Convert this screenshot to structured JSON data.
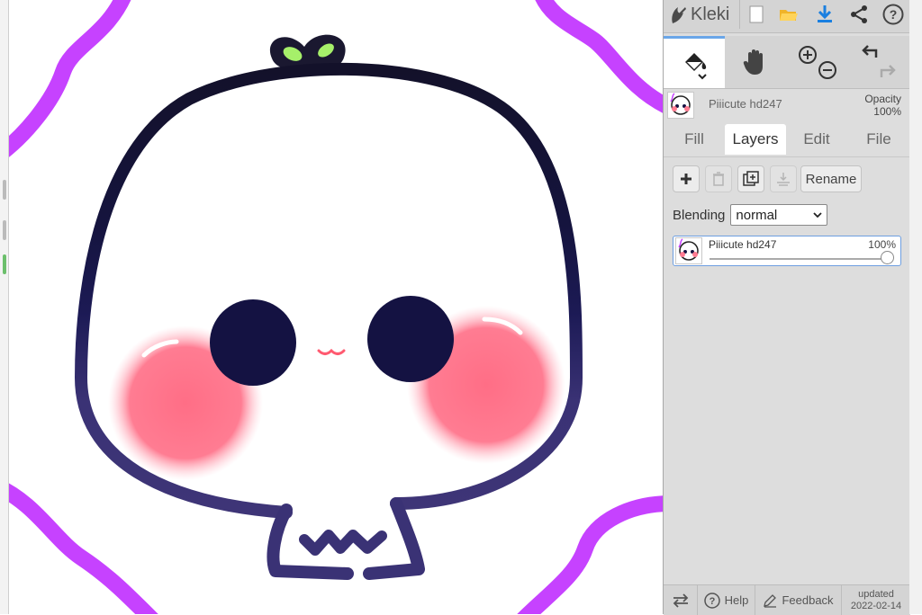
{
  "app": {
    "name": "Kleki"
  },
  "header": {
    "icons": [
      "new-image-icon",
      "open-folder-icon",
      "download-icon",
      "share-icon",
      "help-icon"
    ]
  },
  "tools": {
    "items": [
      "fill-tool",
      "hand-tool",
      "zoom-in",
      "zoom-out",
      "undo",
      "redo"
    ],
    "active": "fill-tool"
  },
  "layer_info": {
    "name": "Piiicute hd247",
    "opacity_label": "Opacity",
    "opacity_value": "100%"
  },
  "tabs": [
    {
      "label": "Fill"
    },
    {
      "label": "Layers"
    },
    {
      "label": "Edit"
    },
    {
      "label": "File"
    }
  ],
  "active_tab": "Layers",
  "layers_panel": {
    "rename_label": "Rename",
    "blending_label": "Blending",
    "blending_value": "normal",
    "layers": [
      {
        "name": "Piiicute hd247",
        "opacity": "100%",
        "opacity_fraction": 1.0
      }
    ]
  },
  "footer": {
    "help_label": "Help",
    "feedback_label": "Feedback",
    "updated_label": "updated",
    "updated_date": "2022-02-14"
  },
  "colors": {
    "accent": "#6aa6e8",
    "sidebar_bg": "#dddddd",
    "purple_stroke": "#c642ff",
    "outline_dark": "#14122e",
    "blush": "#ff6e86",
    "sprout": "#a6f06a"
  }
}
